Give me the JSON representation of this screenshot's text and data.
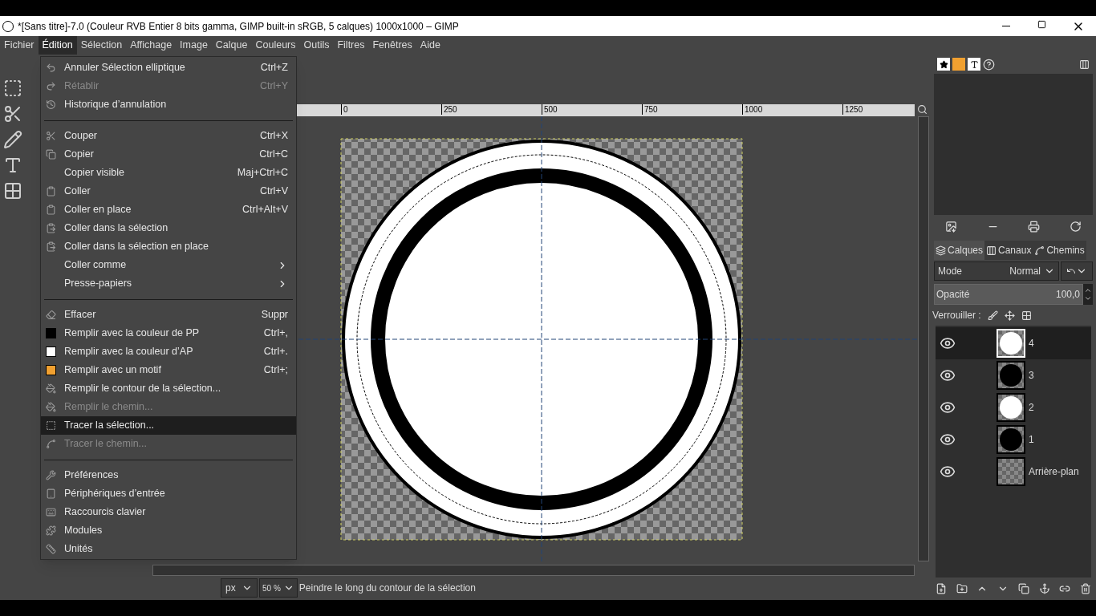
{
  "window": {
    "title": "*[Sans titre]-7.0 (Couleur RVB Entier 8 bits gamma, GIMP built-in sRGB, 5 calques) 1000x1000 – GIMP"
  },
  "menubar": [
    {
      "label": "Fichier",
      "selected": false
    },
    {
      "label": "Édition",
      "selected": true
    },
    {
      "label": "Sélection",
      "selected": false
    },
    {
      "label": "Affichage",
      "selected": false
    },
    {
      "label": "Image",
      "selected": false
    },
    {
      "label": "Calque",
      "selected": false
    },
    {
      "label": "Couleurs",
      "selected": false
    },
    {
      "label": "Outils",
      "selected": false
    },
    {
      "label": "Filtres",
      "selected": false
    },
    {
      "label": "Fenêtres",
      "selected": false
    },
    {
      "label": "Aide",
      "selected": false
    }
  ],
  "menu": [
    {
      "kind": "item",
      "label": "Annuler Sélection elliptique",
      "shortcut": "Ctrl+Z",
      "disabled": false,
      "selected": false
    },
    {
      "kind": "item",
      "label": "Rétablir",
      "shortcut": "Ctrl+Y",
      "disabled": true,
      "selected": false
    },
    {
      "kind": "item",
      "label": "Historique d’annulation",
      "disabled": false,
      "selected": false
    },
    {
      "kind": "separator"
    },
    {
      "kind": "item",
      "label": "Couper",
      "shortcut": "Ctrl+X",
      "disabled": false,
      "selected": false
    },
    {
      "kind": "item",
      "label": "Copier",
      "shortcut": "Ctrl+C",
      "disabled": false,
      "selected": false
    },
    {
      "kind": "item",
      "label": "Copier visible",
      "shortcut": "Maj+Ctrl+C",
      "disabled": false,
      "selected": false
    },
    {
      "kind": "item",
      "label": "Coller",
      "shortcut": "Ctrl+V",
      "disabled": false,
      "selected": false
    },
    {
      "kind": "item",
      "label": "Coller en place",
      "shortcut": "Ctrl+Alt+V",
      "disabled": false,
      "selected": false
    },
    {
      "kind": "item",
      "label": "Coller dans la sélection",
      "disabled": false,
      "selected": false
    },
    {
      "kind": "item",
      "label": "Coller dans la sélection en place",
      "disabled": false,
      "selected": false
    },
    {
      "kind": "submenu",
      "label": "Coller comme",
      "disabled": false,
      "selected": false
    },
    {
      "kind": "submenu",
      "label": "Presse-papiers",
      "disabled": false,
      "selected": false
    },
    {
      "kind": "separator"
    },
    {
      "kind": "item",
      "label": "Effacer",
      "shortcut": "Suppr",
      "disabled": false,
      "selected": false
    },
    {
      "kind": "item",
      "label": "Remplir avec la couleur de PP",
      "shortcut": "Ctrl+,",
      "disabled": false,
      "selected": false,
      "color": "#000000"
    },
    {
      "kind": "item",
      "label": "Remplir avec la couleur d’AP",
      "shortcut": "Ctrl+.",
      "disabled": false,
      "selected": false,
      "color": "#ffffff"
    },
    {
      "kind": "item",
      "label": "Remplir avec un motif",
      "shortcut": "Ctrl+;",
      "disabled": false,
      "selected": false,
      "color": "#f0a030"
    },
    {
      "kind": "item",
      "label": "Remplir le contour de la sélection...",
      "disabled": false,
      "selected": false
    },
    {
      "kind": "item",
      "label": "Remplir le chemin...",
      "disabled": true,
      "selected": false
    },
    {
      "kind": "item",
      "label": "Tracer la sélection...",
      "disabled": false,
      "selected": true
    },
    {
      "kind": "item",
      "label": "Tracer le chemin...",
      "disabled": true,
      "selected": false
    },
    {
      "kind": "separator"
    },
    {
      "kind": "item",
      "label": "Préférences",
      "disabled": false,
      "selected": false
    },
    {
      "kind": "item",
      "label": "Périphériques d’entrée",
      "disabled": false,
      "selected": false
    },
    {
      "kind": "item",
      "label": "Raccourcis clavier",
      "disabled": false,
      "selected": false
    },
    {
      "kind": "item",
      "label": "Modules",
      "disabled": false,
      "selected": false
    },
    {
      "kind": "item",
      "label": "Unités",
      "disabled": false,
      "selected": false
    }
  ],
  "ruler": {
    "ticks": [
      "0",
      "250",
      "500",
      "750",
      "1000",
      "1250"
    ]
  },
  "status_bar": {
    "unit": "px",
    "zoom": "50 %",
    "message": "Peindre le long du contour de la sélection"
  },
  "layers_panel": {
    "tabs": [
      {
        "label": "Calques",
        "selected": true
      },
      {
        "label": "Canaux",
        "selected": false
      },
      {
        "label": "Chemins",
        "selected": false
      }
    ],
    "mode_label": "Mode",
    "mode_value": "Normal",
    "opacity_label": "Opacité",
    "opacity_value": "100,0",
    "opacity": {
      "level": 1
    },
    "lock_label": "Verrouiller :",
    "layers": [
      {
        "name": "4",
        "visible": true,
        "selected": true,
        "kind": "white"
      },
      {
        "name": "3",
        "visible": true,
        "selected": false,
        "kind": "black"
      },
      {
        "name": "2",
        "visible": true,
        "selected": false,
        "kind": "white"
      },
      {
        "name": "1",
        "visible": true,
        "selected": false,
        "kind": "black"
      },
      {
        "name": "Arrière-plan",
        "visible": true,
        "selected": false,
        "kind": "empty"
      }
    ]
  }
}
